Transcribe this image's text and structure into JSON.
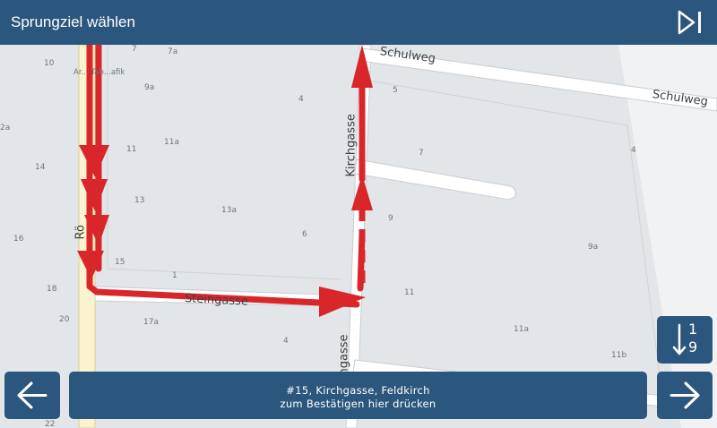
{
  "header": {
    "title": "Sprungziel wählen",
    "skip_icon": "skip-next-icon"
  },
  "map": {
    "streets": {
      "schulweg": "Schulweg",
      "kirchgasse": "Kirchgasse",
      "kirchgasse_lower": "hgasse",
      "steingasse": "Steingasse",
      "left": "Rö",
      "poi": "Ar... Tab...afik"
    },
    "house_numbers": [
      "10",
      "7",
      "7a",
      "9a",
      "4",
      "5",
      "7",
      "4",
      "11",
      "11a",
      "14",
      "13",
      "13a",
      "6",
      "9",
      "16",
      "15",
      "1",
      "18",
      "11",
      "20",
      "17a",
      "4",
      "9a",
      "11a",
      "11b",
      "22",
      "2a"
    ],
    "route_color": "#d9262b"
  },
  "buttons": {
    "prev_icon": "arrow-left-icon",
    "next_icon": "arrow-right-icon",
    "sort_icon": "sort-numeric-icon",
    "sort_top": "1",
    "sort_bottom": "9"
  },
  "confirm": {
    "line1": "#15, Kirchgasse, Feldkirch",
    "line2": "zum Bestätigen hier drücken"
  },
  "colors": {
    "primary": "#2b577e",
    "map_bg": "#e3e6e8",
    "road": "#ffffff"
  }
}
